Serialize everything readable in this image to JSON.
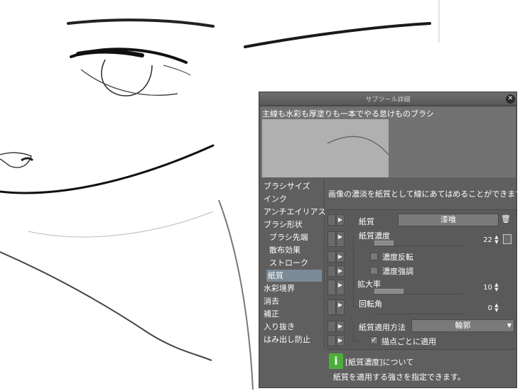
{
  "panel": {
    "title": "サブツール詳細",
    "close_icon": "close-icon",
    "brush_name": "主線も水彩も厚塗りも一本でやる怠けものブラシ",
    "categories": [
      {
        "label": "ブラシサイズ",
        "sub": false,
        "selected": false
      },
      {
        "label": "インク",
        "sub": false,
        "selected": false
      },
      {
        "label": "アンチエイリアス",
        "sub": false,
        "selected": false
      },
      {
        "label": "ブラシ形状",
        "sub": false,
        "selected": false
      },
      {
        "label": "ブラシ先端",
        "sub": true,
        "selected": false
      },
      {
        "label": "散布効果",
        "sub": true,
        "selected": false
      },
      {
        "label": "ストローク",
        "sub": true,
        "selected": false
      },
      {
        "label": "紙質",
        "sub": true,
        "selected": true
      },
      {
        "label": "水彩境界",
        "sub": false,
        "selected": false
      },
      {
        "label": "消去",
        "sub": false,
        "selected": false
      },
      {
        "label": "補正",
        "sub": false,
        "selected": false
      },
      {
        "label": "入り抜き",
        "sub": false,
        "selected": false
      },
      {
        "label": "はみ出し防止",
        "sub": false,
        "selected": false
      }
    ],
    "description": "画像の濃淡を紙質として線にあてはめることができます。",
    "props": {
      "texture_label": "紙質",
      "texture_value": "漆喰",
      "density_label": "紙質濃度",
      "density_value": "22",
      "density_fraction": 0.22,
      "invert_label": "濃度反転",
      "emphasize_label": "濃度強調",
      "scale_label": "拡大率",
      "scale_value": "10",
      "scale_fraction": 0.33,
      "rotation_label": "回転角",
      "rotation_value": "0",
      "rotation_fraction": 0.0,
      "apply_method_label": "紙質適用方法",
      "apply_method_value": "輪郭",
      "per_dab_label": "描点ごとに適用",
      "per_dab_checked": "✓"
    },
    "info": {
      "icon": "info-icon",
      "icon_glyph": "i",
      "title": "[紙質濃度]について",
      "body": "紙質を適用する強さを指定できます。"
    }
  }
}
